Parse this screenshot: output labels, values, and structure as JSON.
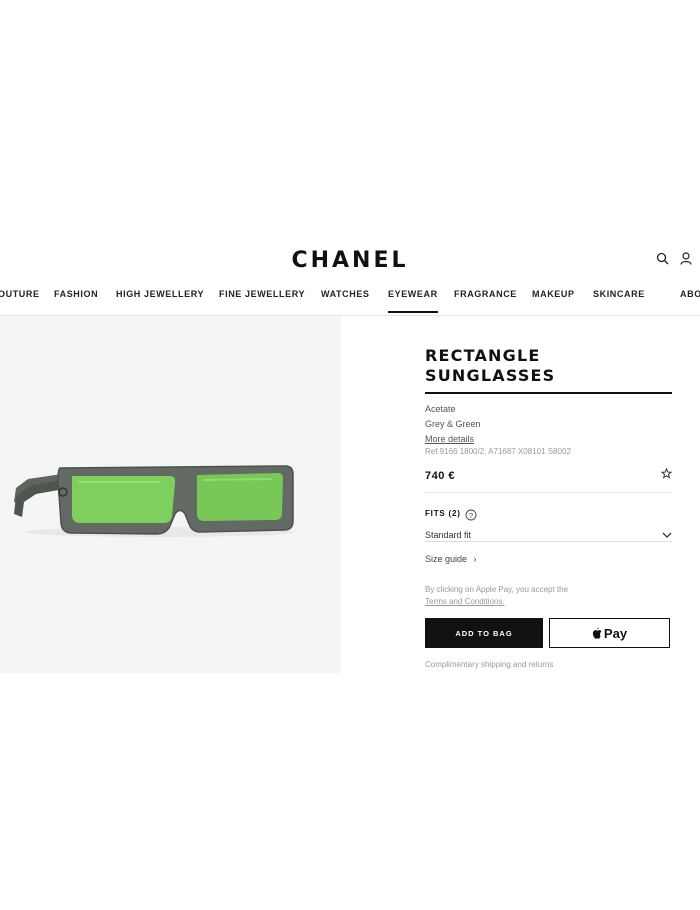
{
  "header": {
    "logo": "CHANEL",
    "icons": [
      "search-icon",
      "account-icon"
    ]
  },
  "nav": {
    "items": [
      {
        "label": "OUTURE"
      },
      {
        "label": "FASHION"
      },
      {
        "label": "HIGH JEWELLERY"
      },
      {
        "label": "FINE JEWELLERY"
      },
      {
        "label": "WATCHES"
      },
      {
        "label": "EYEWEAR",
        "active": true
      },
      {
        "label": "FRAGRANCE"
      },
      {
        "label": "MAKEUP"
      },
      {
        "label": "SKINCARE"
      },
      {
        "label": "ABO"
      }
    ]
  },
  "product": {
    "title_line1": "RECTANGLE",
    "title_line2": "SUNGLASSES",
    "material": "Acetate",
    "color": "Grey & Green",
    "more_details": "More details",
    "ref": "Ref.9166 1800/2, A71687 X08101 S8002",
    "price": "740 €",
    "fits_label": "FITS (2)",
    "fit_selected": "Standard fit",
    "size_guide": "Size guide",
    "applepay_note": "By clicking on Apple Pay, you accept the",
    "terms_link": "Terms and Conditions.",
    "add_to_bag": "ADD TO BAG",
    "apple_pay": "Pay",
    "shipping_note": "Complimentary shipping and returns"
  },
  "colors": {
    "frame": "#5f6660",
    "lens": "#7ecf5e",
    "image_bg": "#f5f5f5",
    "button_dark": "#111111"
  }
}
